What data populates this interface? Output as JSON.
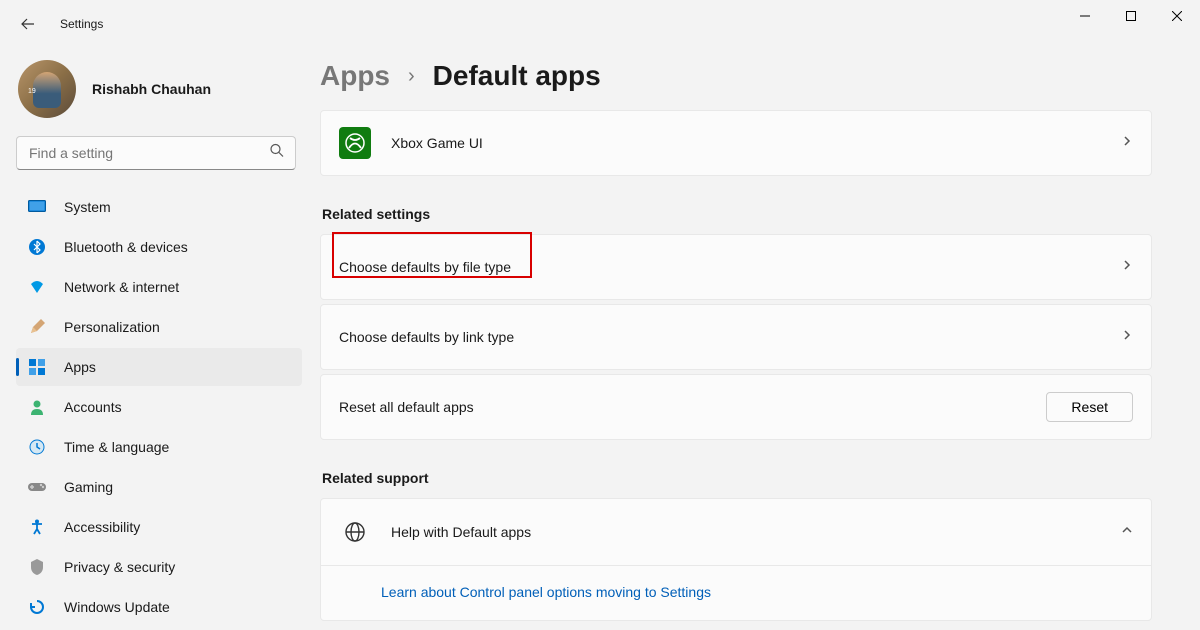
{
  "window": {
    "title": "Settings"
  },
  "profile": {
    "name": "Rishabh Chauhan"
  },
  "search": {
    "placeholder": "Find a setting"
  },
  "nav": {
    "items": [
      {
        "label": "System"
      },
      {
        "label": "Bluetooth & devices"
      },
      {
        "label": "Network & internet"
      },
      {
        "label": "Personalization"
      },
      {
        "label": "Apps"
      },
      {
        "label": "Accounts"
      },
      {
        "label": "Time & language"
      },
      {
        "label": "Gaming"
      },
      {
        "label": "Accessibility"
      },
      {
        "label": "Privacy & security"
      },
      {
        "label": "Windows Update"
      }
    ]
  },
  "breadcrumb": {
    "parent": "Apps",
    "sep": "›",
    "current": "Default apps"
  },
  "xbox": {
    "label": "Xbox Game UI"
  },
  "sections": {
    "related_settings": "Related settings",
    "related_support": "Related support"
  },
  "related": {
    "file_type": "Choose defaults by file type",
    "link_type": "Choose defaults by link type",
    "reset_label": "Reset all default apps",
    "reset_button": "Reset"
  },
  "support": {
    "title": "Help with Default apps",
    "link": "Learn about Control panel options moving to Settings"
  }
}
